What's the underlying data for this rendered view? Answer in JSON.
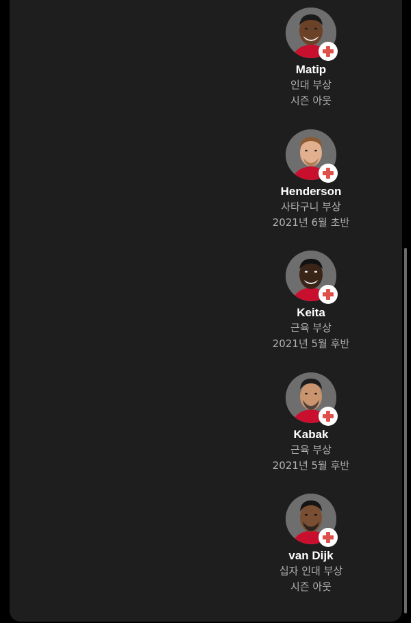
{
  "players": [
    {
      "name": "Matip",
      "injury": "인대 부상",
      "return": "시즌 아웃"
    },
    {
      "name": "Henderson",
      "injury": "사타구니 부상",
      "return": "2021년 6월 초반"
    },
    {
      "name": "Keita",
      "injury": "근육 부상",
      "return": "2021년 5월 후반"
    },
    {
      "name": "Kabak",
      "injury": "근육 부상",
      "return": "2021년 5월 후반"
    },
    {
      "name": "van Dijk",
      "injury": "십자 인대 부상",
      "return": "시즌 아웃"
    }
  ],
  "colors": {
    "background": "#000000",
    "card": "#1e1e1e",
    "avatar_bg": "#6e6e6e",
    "badge_cross": "#e0504a",
    "name_text": "#ffffff",
    "detail_text": "#b0b0b0"
  },
  "icons": {
    "injury_badge": "medical-cross-icon"
  }
}
